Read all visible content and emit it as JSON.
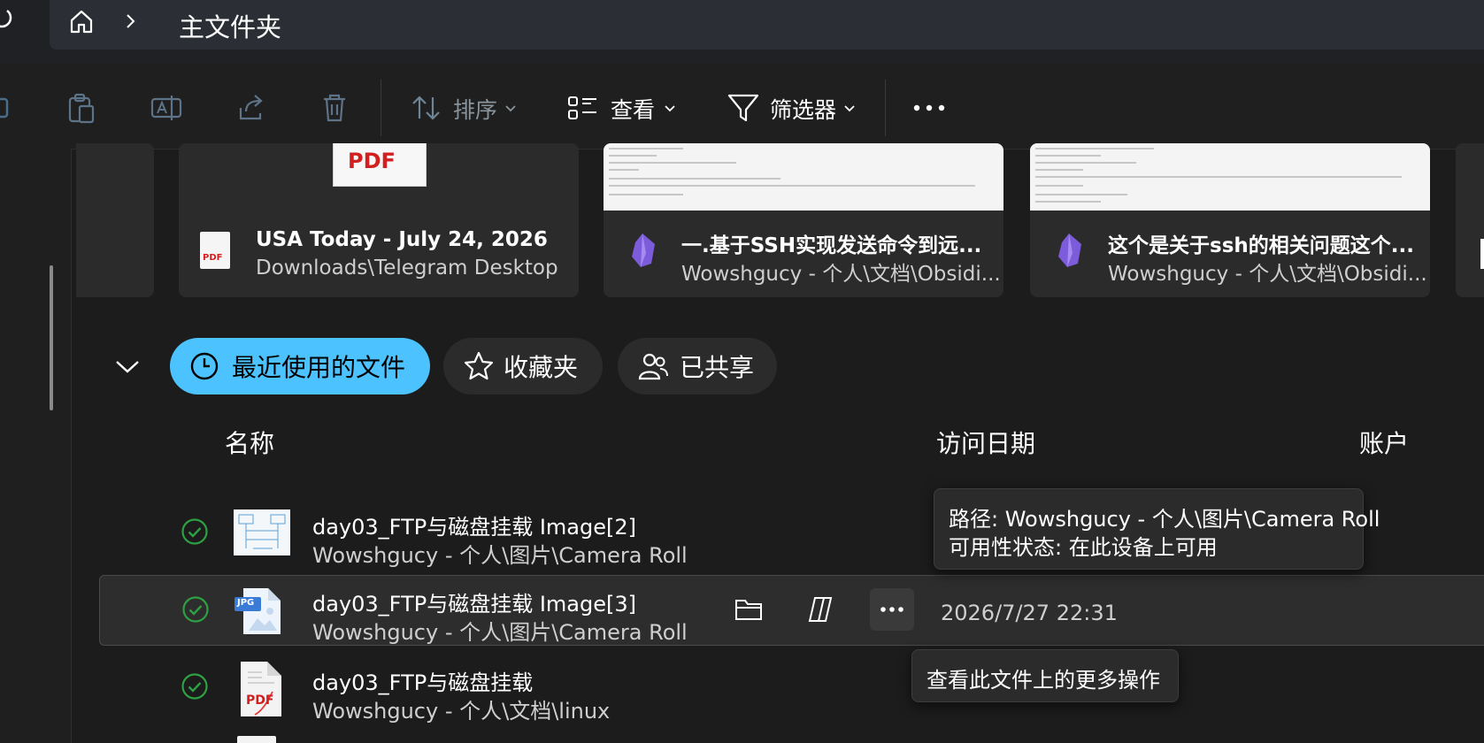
{
  "address_bar": {
    "breadcrumb": "主文件夹"
  },
  "toolbar": {
    "sort_label": "排序",
    "view_label": "查看",
    "filter_label": "筛选器"
  },
  "quick_cards": [
    {
      "title": "USA Today - July 24, 2026",
      "subtitle": "Downloads\\Telegram Desktop",
      "thumb_label": "PDF",
      "file_label": "PDF"
    },
    {
      "title": "一.基于SSH实现发送命令到远...",
      "subtitle": "Wowshgucy - 个人\\文档\\Obsidi..."
    },
    {
      "title": "这个是关于ssh的相关问题这个...",
      "subtitle": "Wowshgucy - 个人\\文档\\Obsidi..."
    }
  ],
  "tabs": [
    {
      "label": "最近使用的文件"
    },
    {
      "label": "收藏夹"
    },
    {
      "label": "已共享"
    }
  ],
  "columns": {
    "name": "名称",
    "accessed": "访问日期",
    "account": "账户"
  },
  "files": [
    {
      "name": "day03_FTP与磁盘挂载 Image[2]",
      "path": "Wowshgucy - 个人\\图片\\Camera Roll",
      "date": ""
    },
    {
      "name": "day03_FTP与磁盘挂载 Image[3]",
      "path": "Wowshgucy - 个人\\图片\\Camera Roll",
      "date": "2026/7/27 22:31",
      "badge": "JPG"
    },
    {
      "name": "day03_FTP与磁盘挂载",
      "path": "Wowshgucy - 个人\\文档\\linux",
      "date": "",
      "badge": "PDF"
    }
  ],
  "tooltips": {
    "path_line": "路径: Wowshgucy - 个人\\图片\\Camera Roll",
    "status_line": "可用性状态: 在此设备上可用",
    "more_actions": "查看此文件上的更多操作"
  },
  "colors": {
    "accent": "#4cc2ff",
    "synced": "#2ea043",
    "background": "#1c1c1c"
  }
}
